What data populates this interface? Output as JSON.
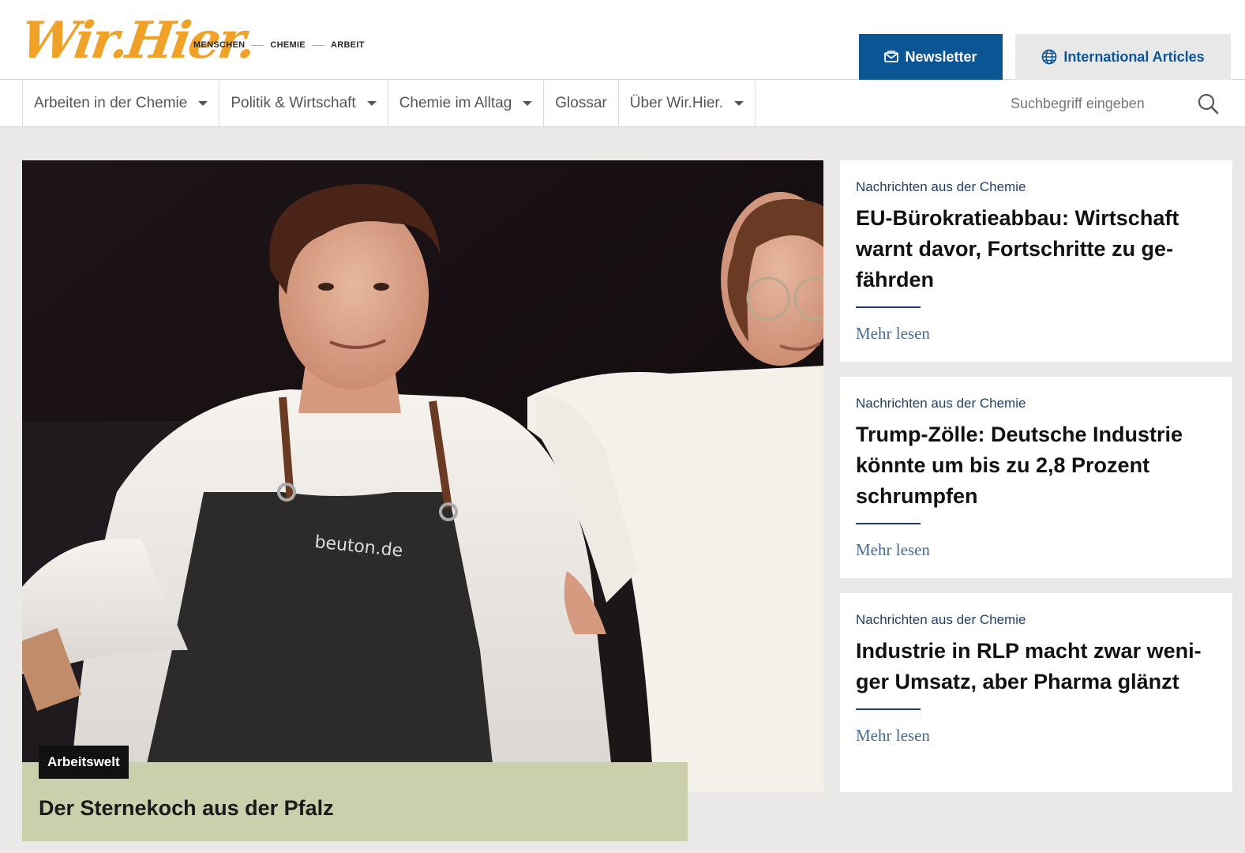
{
  "header": {
    "logo_text": "Wir.Hier.",
    "tagline": [
      "MENSCHEN",
      "CHEMIE",
      "ARBEIT"
    ],
    "newsletter_label": "Newsletter",
    "international_label": "International Articles",
    "accent_color": "#f0a228",
    "primary_color": "#0b5595"
  },
  "nav": {
    "items": [
      {
        "label": "Arbeiten in der Chemie",
        "dropdown": true
      },
      {
        "label": "Politik & Wirtschaft",
        "dropdown": true
      },
      {
        "label": "Chemie im Alltag",
        "dropdown": true
      },
      {
        "label": "Glossar",
        "dropdown": false
      },
      {
        "label": "Über Wir.Hier.",
        "dropdown": true
      }
    ],
    "search_placeholder": "Suchbegriff eingeben"
  },
  "hero": {
    "badge": "Arbeitswelt",
    "title": "Der Sternekoch aus der Pfalz"
  },
  "articles": [
    {
      "category": "Nachrichten aus der Chemie",
      "title": "EU-Bürokratieabbau: Wirtschaft warnt davor, Fortschritte zu ge-fährden",
      "more": "Mehr lesen"
    },
    {
      "category": "Nachrichten aus der Chemie",
      "title": "Trump-Zölle: Deutsche Industrie könnte um bis zu 2,8 Prozent schrumpfen",
      "more": "Mehr lesen"
    },
    {
      "category": "Nachrichten aus der Chemie",
      "title": "Industrie in RLP macht zwar weni-ger Umsatz, aber Pharma glänzt",
      "more": "Mehr lesen"
    }
  ]
}
